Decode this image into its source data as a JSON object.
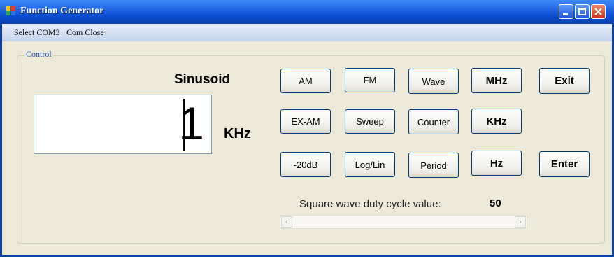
{
  "window": {
    "title": "Function Generator"
  },
  "menu": {
    "items": [
      "Select COM3",
      "Com Close"
    ]
  },
  "group": {
    "label": "Control"
  },
  "display": {
    "mode": "Sinusoid",
    "value": "1",
    "unit": "KHz"
  },
  "buttons": {
    "am": "AM",
    "fm": "FM",
    "wave": "Wave",
    "mhz": "MHz",
    "exit": "Exit",
    "ex_am": "EX-AM",
    "sweep": "Sweep",
    "counter": "Counter",
    "khz": "KHz",
    "minus20db": "-20dB",
    "loglin": "Log/Lin",
    "period": "Period",
    "hz": "Hz",
    "enter": "Enter"
  },
  "duty": {
    "label": "Square wave duty cycle value:",
    "value": "50"
  },
  "colors": {
    "titlebar": "#0a4ccf",
    "window_bg": "#ece9d8",
    "group_label": "#1b4fb3"
  }
}
